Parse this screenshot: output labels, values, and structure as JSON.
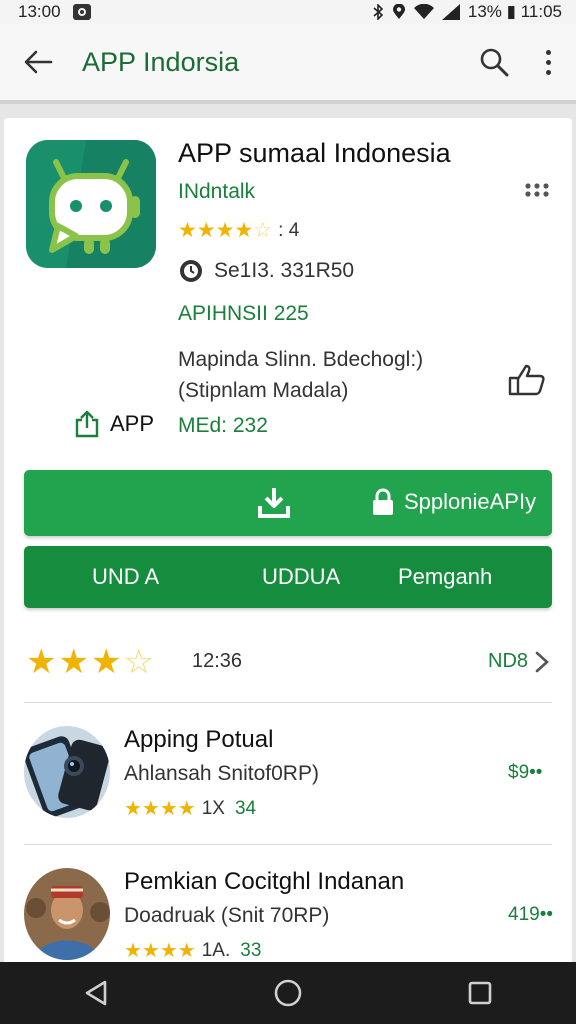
{
  "status_bar": {
    "time": "13:00",
    "right_text": "13% ▮ 11:05"
  },
  "app_bar": {
    "title": "APP Indorsia",
    "icons": [
      "back-arrow-icon",
      "search-icon",
      "more-vert-icon"
    ]
  },
  "app": {
    "title": "APP sumaal Indonesia",
    "developer": "INdntalk",
    "rating_stars": 3.5,
    "rating_text": ": 4",
    "meta_line": "Se1I3. 331R50",
    "versions": "APIHNSII  225",
    "description_line1": "Mapinda Slinn. Bdechogl:)",
    "description_line2": "(Stipnlam Madala)",
    "share_label": "APP",
    "update_label": "MEd: 232"
  },
  "buttons": {
    "install_label": "SpplonieAPIy"
  },
  "tabs": [
    {
      "label": "UND A"
    },
    {
      "label": "UDDUA"
    },
    {
      "label": "Pemganh"
    }
  ],
  "rating_summary": {
    "stars": 3.5,
    "text": "12:36",
    "more_label": "ND8"
  },
  "related_apps": [
    {
      "title": "Apping Potual",
      "subtitle": "Ahlansah Snitof0RP)",
      "stars": 4,
      "count": "1X",
      "count2": "34",
      "price": "$9••"
    },
    {
      "title": "Pemkian Cocitghl Indanan",
      "subtitle": "Doadruak (Snit 70RP)",
      "stars": 4,
      "count": "1A.",
      "count2": "33",
      "price": "419••"
    }
  ],
  "colors": {
    "accent_green": "#21a44d",
    "dark_green": "#168d3e",
    "text_green": "#1a7f3b",
    "star": "#f0b400",
    "nav_bg": "#1c1c1c"
  }
}
